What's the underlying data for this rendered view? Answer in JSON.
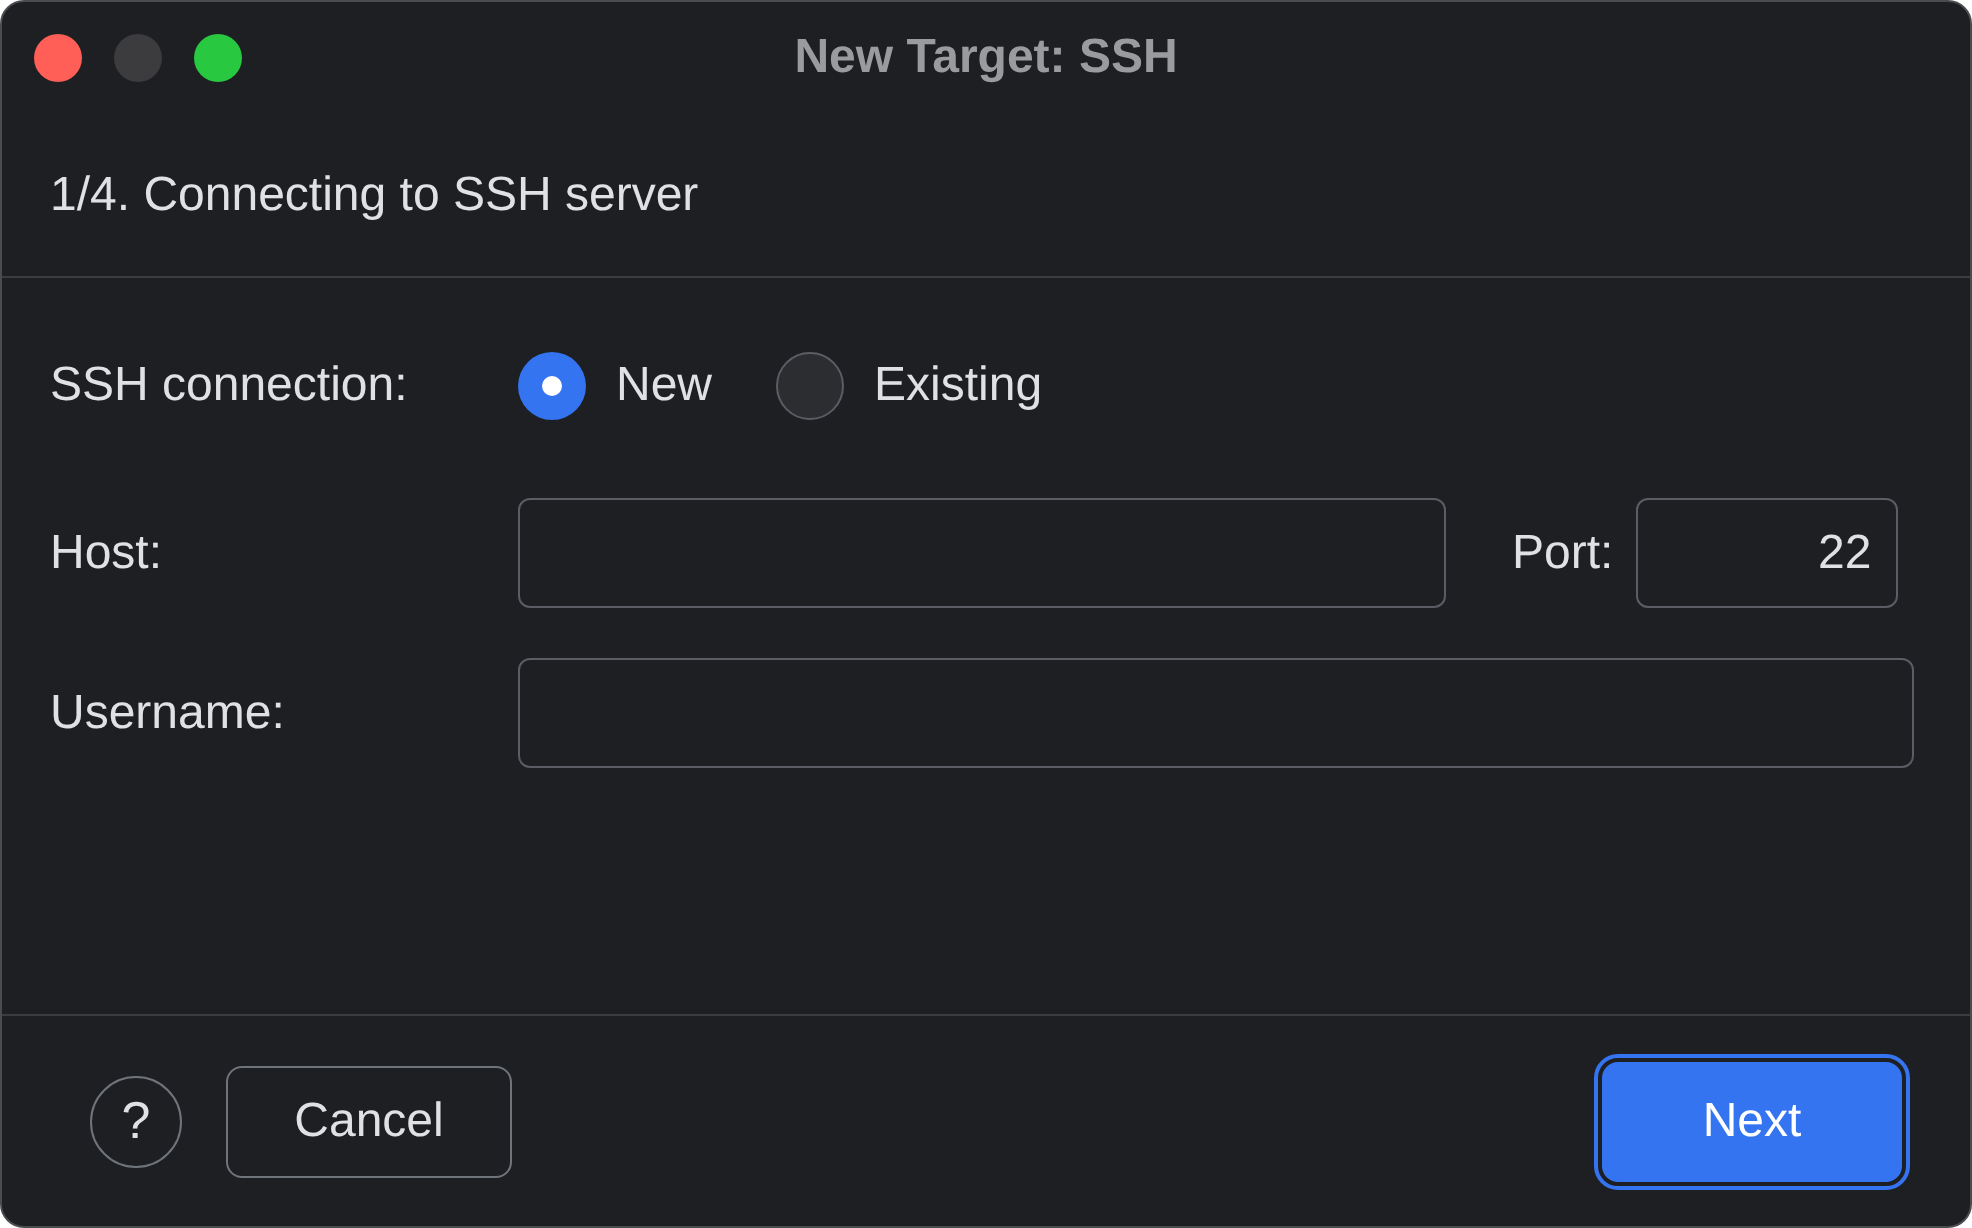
{
  "window": {
    "title": "New Target: SSH"
  },
  "step": "1/4. Connecting to SSH server",
  "connection": {
    "label": "SSH connection:",
    "options": [
      {
        "label": "New",
        "selected": true
      },
      {
        "label": "Existing",
        "selected": false
      }
    ]
  },
  "host": {
    "label": "Host:"
  },
  "port": {
    "label": "Port:",
    "value": "22"
  },
  "username": {
    "label": "Username:"
  },
  "help": "?",
  "buttons": [
    {
      "label": "Cancel",
      "kind": "secondary"
    },
    {
      "label": "Next",
      "kind": "primary"
    }
  ]
}
